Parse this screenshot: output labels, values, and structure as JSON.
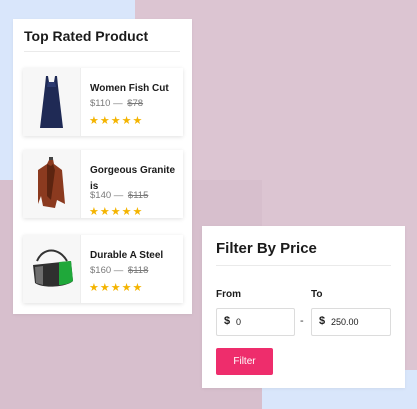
{
  "products_widget": {
    "title": "Top Rated Product",
    "items": [
      {
        "name": "Women Fish Cut",
        "price": "$110",
        "separator": "—",
        "old_price": "$78",
        "stars": "★★★★★",
        "image_icon": "dress-icon"
      },
      {
        "name": "Gorgeous Granite is",
        "price": "$140",
        "separator": "—",
        "old_price": "$115",
        "stars": "★★★★★",
        "image_icon": "jacket-icon"
      },
      {
        "name": "Durable A Steel",
        "price": "$160",
        "separator": "—",
        "old_price": "$118",
        "stars": "★★★★★",
        "image_icon": "bag-icon"
      }
    ]
  },
  "filter_widget": {
    "title": "Filter By Price",
    "from_label": "From",
    "to_label": "To",
    "from_currency": "$",
    "from_value": "0",
    "separator": "-",
    "to_currency": "$",
    "to_value": "250.00",
    "button_label": "Filter"
  },
  "colors": {
    "accent": "#ee2d6c",
    "star": "#f4b400",
    "background_blue": "#d9e6fb",
    "background_mauve": "#dcc5d2"
  }
}
